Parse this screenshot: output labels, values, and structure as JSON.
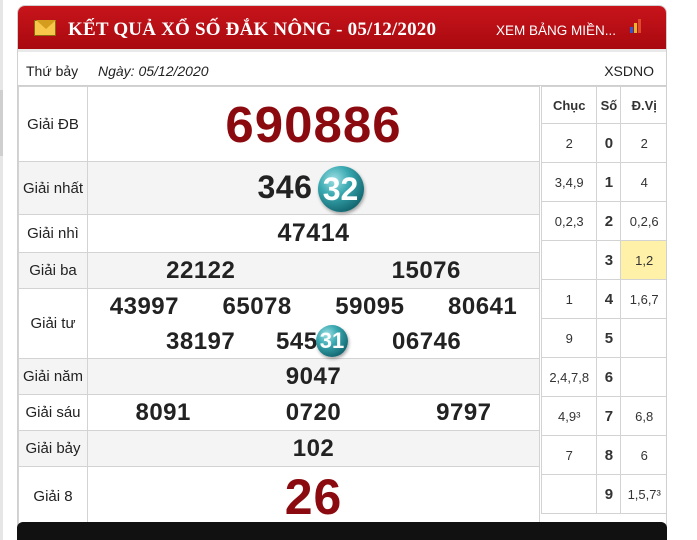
{
  "header": {
    "title": "KẾT QUẢ XỔ SỐ ĐẮK NÔNG - 05/12/2020",
    "link_label": "XEM BẢNG MIỀN...",
    "icon_name": "mail-icon",
    "flag_icon": "bar-chart-icon",
    "accent_color": "#b50e15"
  },
  "subbar": {
    "day": "Thứ bảy",
    "date": "Ngày: 05/12/2020",
    "code": "XSDNO"
  },
  "results": {
    "db": {
      "label": "Giải ĐB",
      "value": "690886"
    },
    "g1": {
      "label": "Giải nhất",
      "value": "346",
      "ball": "32"
    },
    "g2": {
      "label": "Giải nhì",
      "value": "47414"
    },
    "g3": {
      "label": "Giải ba",
      "values": [
        "22122",
        "15076"
      ]
    },
    "g4": {
      "label": "Giải tư",
      "row1": [
        "43997",
        "65078",
        "59095",
        "80641"
      ],
      "row2_a": "38197",
      "row2_b": "545",
      "row2_ball": "31",
      "row2_c": "06746"
    },
    "g5": {
      "label": "Giải năm",
      "value": "9047"
    },
    "g6": {
      "label": "Giải sáu",
      "values": [
        "8091",
        "0720",
        "9797"
      ]
    },
    "g7": {
      "label": "Giải bảy",
      "value": "102"
    },
    "g8": {
      "label": "Giải 8",
      "value": "26"
    }
  },
  "loto": {
    "headers": [
      "Chục",
      "Số",
      "Đ.Vị"
    ],
    "rows": [
      {
        "chuc": "2",
        "so": "0",
        "dvi": "2"
      },
      {
        "chuc": "3,4,9",
        "so": "1",
        "dvi": "4"
      },
      {
        "chuc": "0,2,3",
        "so": "2",
        "dvi": "0,2,6"
      },
      {
        "chuc": "",
        "so": "3",
        "dvi": "1,2"
      },
      {
        "chuc": "1",
        "so": "4",
        "dvi": "1,6,7"
      },
      {
        "chuc": "9",
        "so": "5",
        "dvi": ""
      },
      {
        "chuc": "2,4,7,8",
        "so": "6",
        "dvi": ""
      },
      {
        "chuc": "4,9³",
        "so": "7",
        "dvi": "6,8"
      },
      {
        "chuc": "7",
        "so": "8",
        "dvi": "6"
      },
      {
        "chuc": "",
        "so": "9",
        "dvi": "1,5,7³"
      }
    ]
  }
}
